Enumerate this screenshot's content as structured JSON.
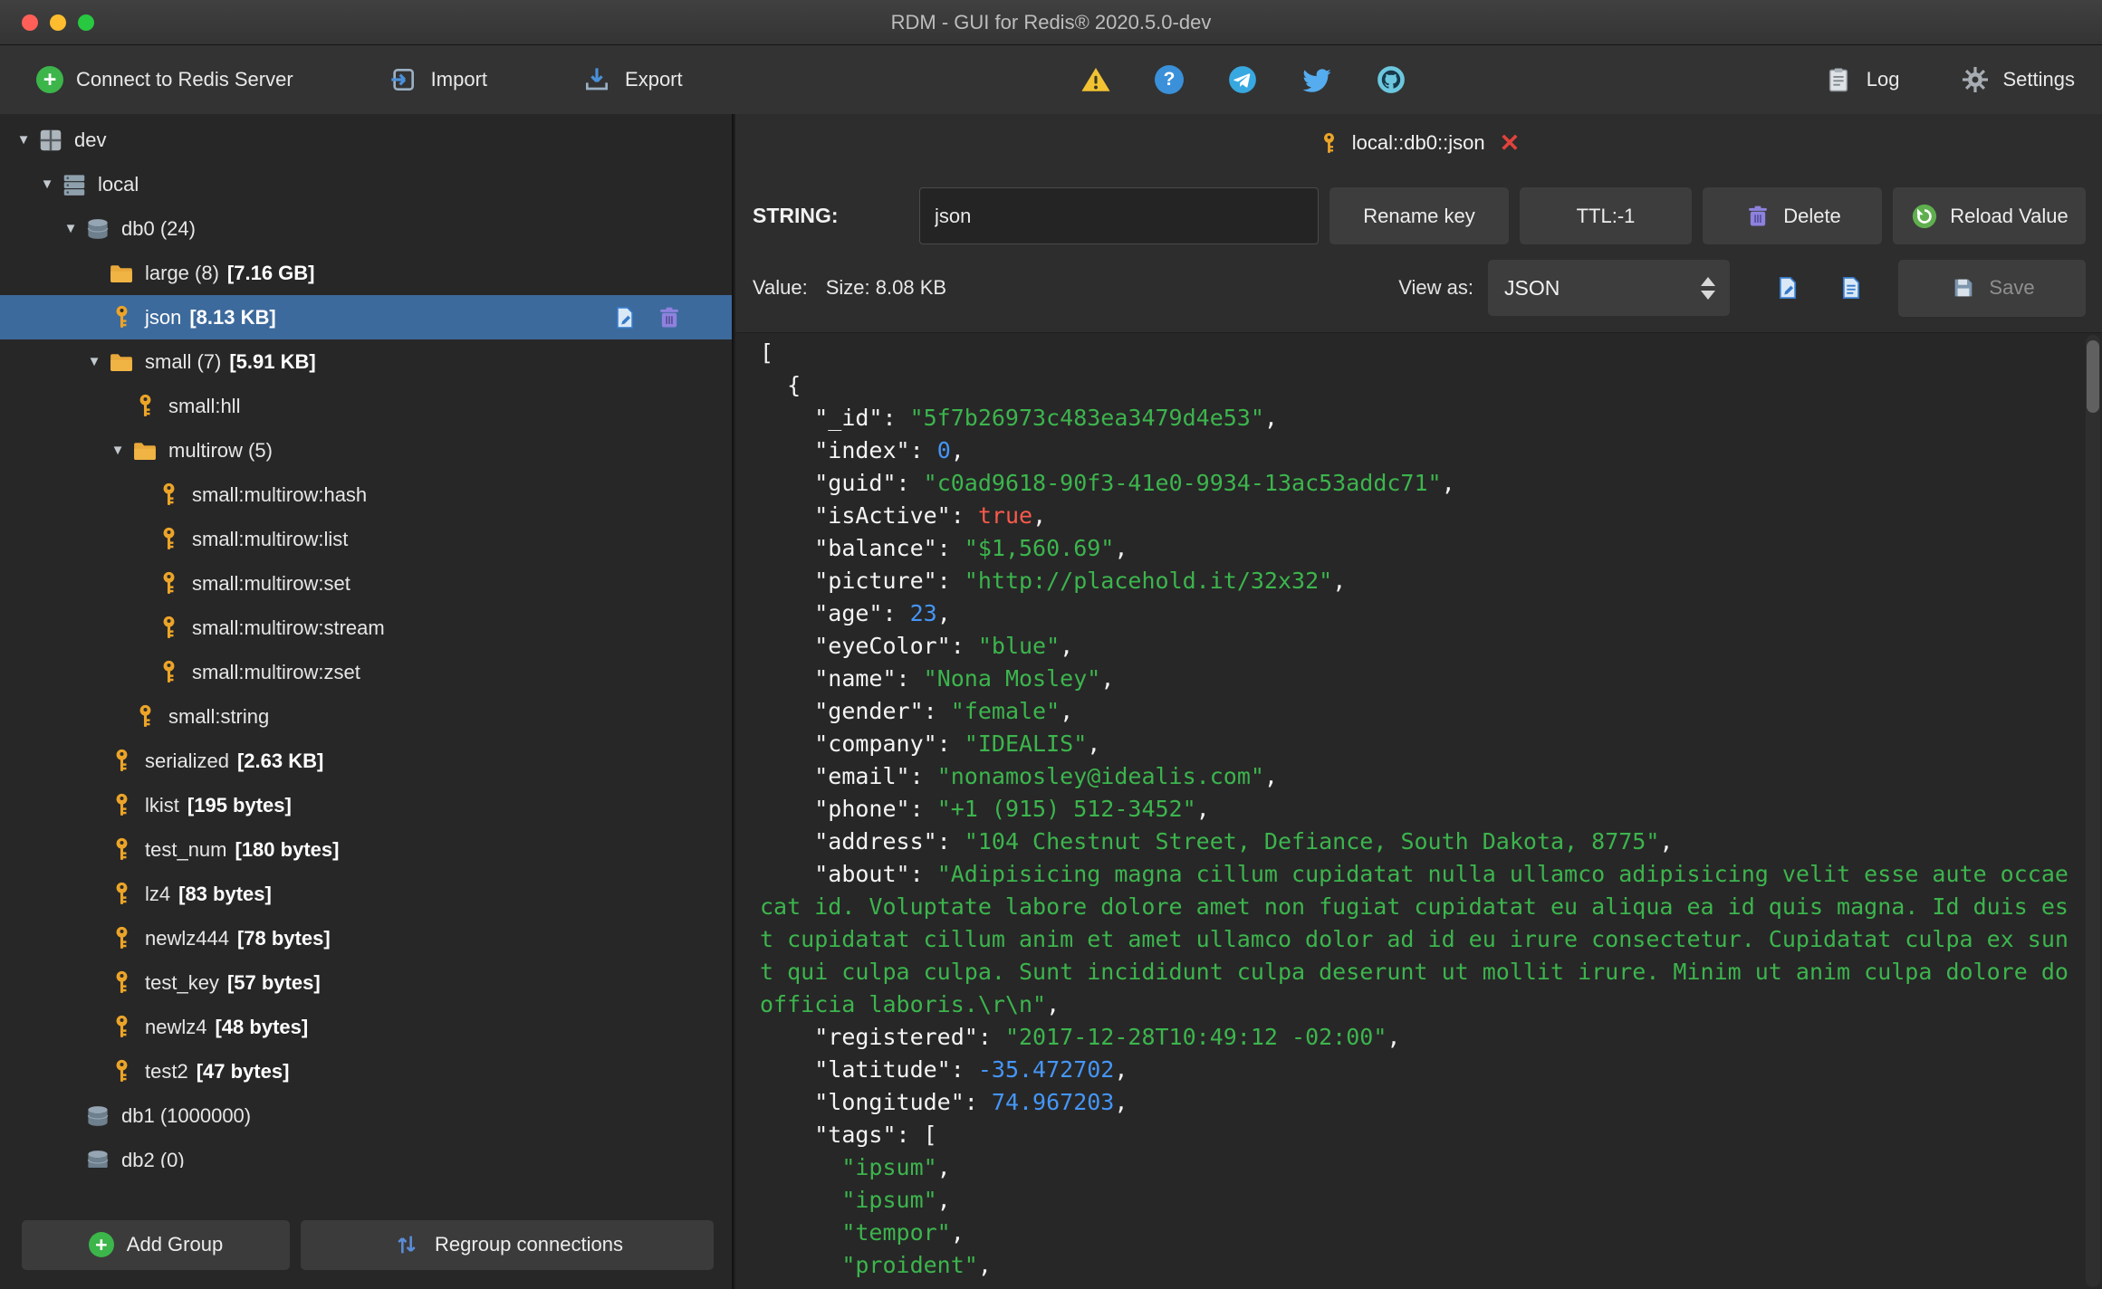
{
  "window": {
    "title": "RDM - GUI for Redis® 2020.5.0-dev"
  },
  "toolbar": {
    "connect_label": "Connect to Redis Server",
    "import_label": "Import",
    "export_label": "Export",
    "log_label": "Log",
    "settings_label": "Settings",
    "plus_glyph": "+",
    "help_glyph": "?"
  },
  "sidebar": {
    "expander_glyph": "▼",
    "add_group_label": "Add Group",
    "regroup_label": "Regroup connections",
    "tree": [
      {
        "name": "dev",
        "icon": "server",
        "level": 0,
        "expander": true
      },
      {
        "name": "local",
        "icon": "connection",
        "level": 1,
        "expander": true
      },
      {
        "name": "db0",
        "count": "(24)",
        "icon": "db",
        "level": 2,
        "expander": true
      },
      {
        "name": "large",
        "count": "(8)",
        "size": "[7.16 GB]",
        "icon": "folder",
        "level": 3
      },
      {
        "name": "json",
        "size": "[8.13 KB]",
        "icon": "key",
        "level": 3,
        "selected": true,
        "actions": true
      },
      {
        "name": "small",
        "count": "(7)",
        "size": "[5.91 KB]",
        "icon": "folder",
        "level": 3,
        "expander": true
      },
      {
        "name": "small:hll",
        "icon": "key",
        "level": 4
      },
      {
        "name": "multirow",
        "count": "(5)",
        "icon": "folder",
        "level": 4,
        "expander": true
      },
      {
        "name": "small:multirow:hash",
        "icon": "key",
        "level": 5
      },
      {
        "name": "small:multirow:list",
        "icon": "key",
        "level": 5
      },
      {
        "name": "small:multirow:set",
        "icon": "key",
        "level": 5
      },
      {
        "name": "small:multirow:stream",
        "icon": "key",
        "level": 5
      },
      {
        "name": "small:multirow:zset",
        "icon": "key",
        "level": 5
      },
      {
        "name": "small:string",
        "icon": "key",
        "level": 4
      },
      {
        "name": "serialized",
        "size": "[2.63 KB]",
        "icon": "key",
        "level": 3
      },
      {
        "name": "lkist",
        "size": "[195 bytes]",
        "icon": "key",
        "level": 3
      },
      {
        "name": "test_num",
        "size": "[180 bytes]",
        "icon": "key",
        "level": 3
      },
      {
        "name": "lz4",
        "size": "[83 bytes]",
        "icon": "key",
        "level": 3
      },
      {
        "name": "newlz444",
        "size": "[78 bytes]",
        "icon": "key",
        "level": 3
      },
      {
        "name": "test_key",
        "size": "[57 bytes]",
        "icon": "key",
        "level": 3
      },
      {
        "name": "newlz4",
        "size": "[48 bytes]",
        "icon": "key",
        "level": 3
      },
      {
        "name": "test2",
        "size": "[47 bytes]",
        "icon": "key",
        "level": 3
      },
      {
        "name": "db1",
        "count": "(1000000)",
        "icon": "db",
        "level": 2
      },
      {
        "name": "db2",
        "count": "(0)",
        "icon": "db",
        "level": 2
      }
    ]
  },
  "editor": {
    "tab": {
      "title": "local::db0::json",
      "close_glyph": "✕"
    },
    "key_type": "STRING:",
    "key_name": "json",
    "rename_label": "Rename key",
    "ttl_label": "TTL:-1",
    "delete_label": "Delete",
    "reload_label": "Reload Value",
    "value_label": "Value:",
    "size_label": "Size: 8.08 KB",
    "view_as_label": "View as:",
    "view_mode": "JSON",
    "save_label": "Save",
    "lines": [
      [
        [
          "p",
          "["
        ]
      ],
      [
        [
          "p",
          "  {"
        ]
      ],
      [
        [
          "p",
          "    \"_id\": "
        ],
        [
          "s",
          "\"5f7b26973c483ea3479d4e53\""
        ],
        [
          "p",
          ","
        ]
      ],
      [
        [
          "p",
          "    \"index\": "
        ],
        [
          "n",
          "0"
        ],
        [
          "p",
          ","
        ]
      ],
      [
        [
          "p",
          "    \"guid\": "
        ],
        [
          "s",
          "\"c0ad9618-90f3-41e0-9934-13ac53addc71\""
        ],
        [
          "p",
          ","
        ]
      ],
      [
        [
          "p",
          "    \"isActive\": "
        ],
        [
          "b",
          "true"
        ],
        [
          "p",
          ","
        ]
      ],
      [
        [
          "p",
          "    \"balance\": "
        ],
        [
          "s",
          "\"$1,560.69\""
        ],
        [
          "p",
          ","
        ]
      ],
      [
        [
          "p",
          "    \"picture\": "
        ],
        [
          "s",
          "\"http://placehold.it/32x32\""
        ],
        [
          "p",
          ","
        ]
      ],
      [
        [
          "p",
          "    \"age\": "
        ],
        [
          "n",
          "23"
        ],
        [
          "p",
          ","
        ]
      ],
      [
        [
          "p",
          "    \"eyeColor\": "
        ],
        [
          "s",
          "\"blue\""
        ],
        [
          "p",
          ","
        ]
      ],
      [
        [
          "p",
          "    \"name\": "
        ],
        [
          "s",
          "\"Nona Mosley\""
        ],
        [
          "p",
          ","
        ]
      ],
      [
        [
          "p",
          "    \"gender\": "
        ],
        [
          "s",
          "\"female\""
        ],
        [
          "p",
          ","
        ]
      ],
      [
        [
          "p",
          "    \"company\": "
        ],
        [
          "s",
          "\"IDEALIS\""
        ],
        [
          "p",
          ","
        ]
      ],
      [
        [
          "p",
          "    \"email\": "
        ],
        [
          "s",
          "\"nonamosley@idealis.com\""
        ],
        [
          "p",
          ","
        ]
      ],
      [
        [
          "p",
          "    \"phone\": "
        ],
        [
          "s",
          "\"+1 (915) 512-3452\""
        ],
        [
          "p",
          ","
        ]
      ],
      [
        [
          "p",
          "    \"address\": "
        ],
        [
          "s",
          "\"104 Chestnut Street, Defiance, South Dakota, 8775\""
        ],
        [
          "p",
          ","
        ]
      ],
      [
        [
          "p",
          "    \"about\": "
        ],
        [
          "s",
          "\"Adipisicing magna cillum cupidatat nulla ullamco adipisicing velit esse aute occaecat id. Voluptate labore dolore amet non fugiat cupidatat eu aliqua ea id quis magna. Id duis est cupidatat cillum anim et amet ullamco dolor ad id eu irure consectetur. Cupidatat culpa ex sunt qui culpa culpa. Sunt incididunt culpa deserunt ut mollit irure. Minim ut anim culpa dolore do officia laboris.\\r\\n\""
        ],
        [
          "p",
          ","
        ]
      ],
      [
        [
          "p",
          "    \"registered\": "
        ],
        [
          "s",
          "\"2017-12-28T10:49:12 -02:00\""
        ],
        [
          "p",
          ","
        ]
      ],
      [
        [
          "p",
          "    \"latitude\": "
        ],
        [
          "n",
          "-35.472702"
        ],
        [
          "p",
          ","
        ]
      ],
      [
        [
          "p",
          "    \"longitude\": "
        ],
        [
          "n",
          "74.967203"
        ],
        [
          "p",
          ","
        ]
      ],
      [
        [
          "p",
          "    \"tags\": ["
        ]
      ],
      [
        [
          "p",
          "      "
        ],
        [
          "s",
          "\"ipsum\""
        ],
        [
          "p",
          ","
        ]
      ],
      [
        [
          "p",
          "      "
        ],
        [
          "s",
          "\"ipsum\""
        ],
        [
          "p",
          ","
        ]
      ],
      [
        [
          "p",
          "      "
        ],
        [
          "s",
          "\"tempor\""
        ],
        [
          "p",
          ","
        ]
      ],
      [
        [
          "p",
          "      "
        ],
        [
          "s",
          "\"proident\""
        ],
        [
          "p",
          ","
        ]
      ]
    ]
  },
  "icons": {
    "toolbar": [
      "plus-circle",
      "import-arrow",
      "export-arrow",
      "warning-triangle",
      "question-circle",
      "telegram",
      "twitter-bird",
      "github",
      "clipboard",
      "gear"
    ],
    "tree": [
      "grid-server",
      "server-stack",
      "database-cylinder",
      "folder",
      "key",
      "document-edit",
      "trash"
    ],
    "editor": [
      "key",
      "close-x",
      "trash",
      "refresh-circle",
      "document-edit",
      "document",
      "floppy",
      "up-down-arrows"
    ]
  },
  "colors": {
    "accent_selected": "#3d6a9c",
    "json_string": "#3cb54d",
    "json_number": "#4596f7",
    "json_bool": "#fa5a4b",
    "key_icon": "#eca428",
    "success_green": "#3cb54a"
  }
}
